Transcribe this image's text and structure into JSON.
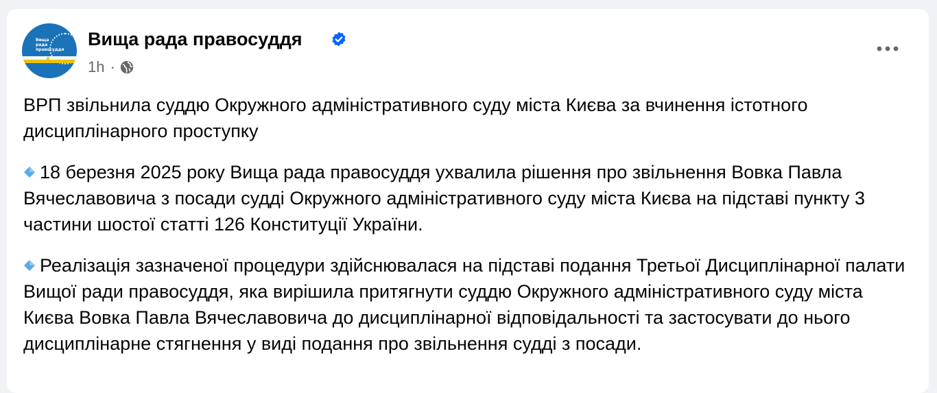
{
  "post": {
    "page_name": "Вища рада правосуддя",
    "timestamp": "1h",
    "separator": "·",
    "audience_icon": "globe-icon",
    "verified_icon": "verified-badge-icon",
    "more_icon": "more-options-icon",
    "avatar": {
      "text_line1": "Вища",
      "text_line2": "рада",
      "text_line3": "правосуддя",
      "colors": {
        "background": "#1a73b8",
        "flag_top": "#ffffff",
        "flag_bottom": "#f6c500"
      }
    },
    "paragraph1": "ВРП звільнила суддю Окружного адміністративного суду міста Києва за вчинення істотного дисциплінарного проступку",
    "paragraph2": "18 березня 2025 року Вища рада правосуддя ухвалила рішення про звільнення Вовка Павла Вячеславовича з посади судді Окружного адміністративного суду міста Києва на підставі пункту 3 частини шостої статті 126 Конституції України.",
    "paragraph3": "Реалізація зазначеної процедури здійснювалася на підставі подання Третьої Дисциплінарної палати Вищої ради правосуддя, яка вирішила притягнути суддю Окружного адміністративного суду міста Києва Вовка Павла Вячеславовича до дисциплінарної відповідальності та застосувати до нього дисциплінарне стягнення у виді подання про звільнення судді з посади.",
    "bullet_icon": "blue-diamond-icon"
  },
  "colors": {
    "page_background": "#f0f2f5",
    "card_background": "#ffffff",
    "text_primary": "#050505",
    "text_secondary": "#65676b",
    "verified_blue": "#0866ff",
    "diamond_blue": "#5aa9e6"
  }
}
